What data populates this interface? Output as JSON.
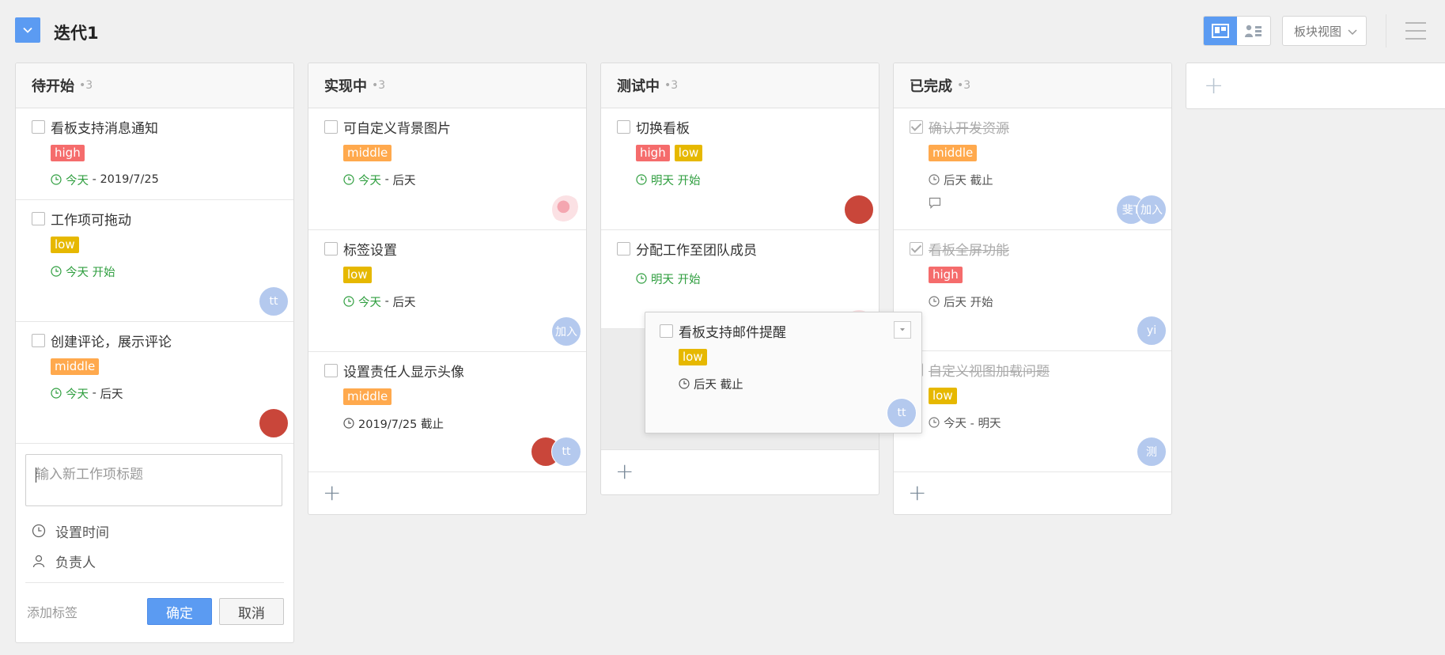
{
  "header": {
    "title": "迭代1",
    "view_select": "板块视图"
  },
  "columns": [
    {
      "title": "待开始",
      "count": "•3",
      "cards": [
        {
          "title": "看板支持消息通知",
          "tags": [
            "high"
          ],
          "time_start": "今天",
          "time_sep": " - ",
          "time_end": "2019/7/25"
        },
        {
          "title": "工作项可拖动",
          "tags": [
            "low"
          ],
          "time": "今天 开始",
          "assignees": [
            "tt"
          ]
        },
        {
          "title": "创建评论，展示评论",
          "tags": [
            "middle"
          ],
          "time_start": "今天",
          "time_sep": " - ",
          "time_end": "后天"
        }
      ],
      "new_form": {
        "placeholder": "输入新工作项标题",
        "set_time": "设置时间",
        "assignee": "负责人",
        "add_tag": "添加标签",
        "confirm": "确定",
        "cancel": "取消"
      }
    },
    {
      "title": "实现中",
      "count": "•3",
      "cards": [
        {
          "title": "可自定义背景图片",
          "tags": [
            "middle"
          ],
          "time_start": "今天",
          "time_sep": " - ",
          "time_end": "后天"
        },
        {
          "title": "标签设置",
          "tags": [
            "low"
          ],
          "time_start": "今天",
          "time_sep": " - ",
          "time_end": "后天",
          "assignees": [
            "加入"
          ]
        },
        {
          "title": "设置责任人显示头像",
          "tags": [
            "middle"
          ],
          "time": "2019/7/25 截止",
          "assignees": [
            "tt"
          ]
        }
      ]
    },
    {
      "title": "测试中",
      "count": "•3",
      "cards": [
        {
          "title": "切换看板",
          "tags": [
            "high",
            "low"
          ],
          "time": "明天 开始"
        },
        {
          "title": "分配工作至团队成员",
          "time": "明天 开始"
        }
      ]
    },
    {
      "title": "已完成",
      "count": "•3",
      "cards": [
        {
          "title": "确认开发资源",
          "tags": [
            "middle"
          ],
          "time": "后天 截止",
          "assignees": [
            "斐T",
            "加入"
          ]
        },
        {
          "title": "看板全屏功能",
          "tags": [
            "high"
          ],
          "time": "后天 开始",
          "assignees": [
            "yi"
          ]
        },
        {
          "title": "自定义视图加载问题",
          "tags": [
            "low"
          ],
          "time": "今天 - 明天",
          "assignees": [
            "测"
          ]
        }
      ]
    }
  ],
  "dragging_card": {
    "title": "看板支持邮件提醒",
    "tags": [
      "low"
    ],
    "time": "后天 截止",
    "assignees": [
      "tt"
    ]
  },
  "colors": {
    "accent": "#5b9bf2",
    "high": "#f56c6c",
    "low": "#e6b800",
    "middle": "#ffa94d",
    "green_time": "#2f9e3f"
  }
}
